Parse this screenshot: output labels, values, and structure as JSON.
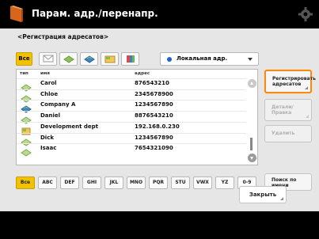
{
  "header": {
    "title": "Парам. адр./перенапр."
  },
  "breadcrumb": "<Регистрация адресатов>",
  "type_filter": {
    "all_label": "Все",
    "selected_destination": "Локальная адр."
  },
  "list": {
    "columns": {
      "type": "тип",
      "name": "имя",
      "address": "адрес"
    },
    "rows": [
      {
        "icon": "email-icon",
        "name": "Carol",
        "address": "876543210"
      },
      {
        "icon": "email-icon",
        "name": "Chloe",
        "address": "2345678900"
      },
      {
        "icon": "fax-icon",
        "name": "Company A",
        "address": "1234567890"
      },
      {
        "icon": "email-icon",
        "name": "Daniel",
        "address": "8876543210"
      },
      {
        "icon": "group-icon",
        "name": "Development dept",
        "address": "192.168.0.230"
      },
      {
        "icon": "email-icon",
        "name": "Dick",
        "address": "1234567890"
      },
      {
        "icon": "email-icon",
        "name": "Isaac",
        "address": "7654321090"
      }
    ]
  },
  "actions": {
    "register_line1": "Регистрировать",
    "register_line2": "адресатов",
    "detail_line1": "Детали/",
    "detail_line2": "Правка",
    "delete": "Удалить",
    "search_line1": "Поиск по",
    "search_line2": "имени"
  },
  "alphabet_tabs": [
    "Все",
    "ABC",
    "DEF",
    "GHI",
    "JKL",
    "MNO",
    "PQR",
    "STU",
    "VWX",
    "YZ",
    "0-9"
  ],
  "footer": {
    "close": "Закрыть"
  },
  "colors": {
    "accent": "#f2c200",
    "highlight": "#f08c1e",
    "bar": "#000000"
  }
}
